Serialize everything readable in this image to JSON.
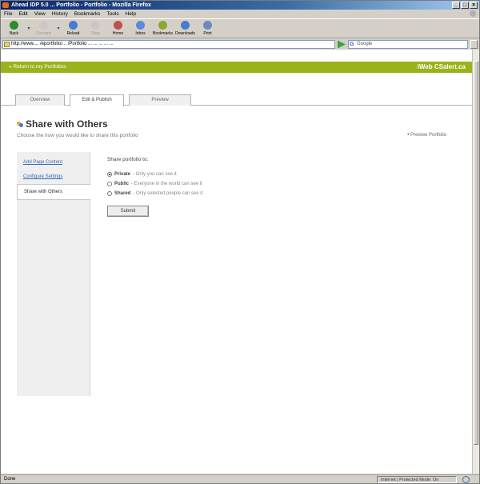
{
  "window": {
    "title": "Ahead IDP 5.0 ... Portfolio - Portfolio - Mozilla Firefox",
    "controls": [
      "_",
      "□",
      "×"
    ]
  },
  "menu": [
    "File",
    "Edit",
    "View",
    "History",
    "Bookmarks",
    "Tools",
    "Help"
  ],
  "toolbar": [
    {
      "label": "Back",
      "icon": "back-arrow-icon",
      "color": "#2e8b2e",
      "enabled": true
    },
    {
      "label": "Forward",
      "icon": "forward-arrow-icon",
      "color": "#c8c8c8",
      "enabled": false
    },
    {
      "label": "Reload",
      "icon": "reload-icon",
      "color": "#4a7bd0",
      "enabled": true
    },
    {
      "label": "Stop",
      "icon": "stop-icon",
      "color": "#c8c8c8",
      "enabled": false
    },
    {
      "label": "Home",
      "icon": "home-icon",
      "color": "#c0504d",
      "enabled": true
    },
    {
      "label": "Inbox",
      "icon": "inbox-icon",
      "color": "#5a8ad8",
      "enabled": true
    },
    {
      "label": "Bookmarks",
      "icon": "bookmarks-icon",
      "color": "#8aa830",
      "enabled": true
    },
    {
      "label": "Downloads",
      "icon": "downloads-icon",
      "color": "#4a7bd0",
      "enabled": true
    },
    {
      "label": "Print",
      "icon": "print-icon",
      "color": "#6a8ac0",
      "enabled": true
    }
  ],
  "address": {
    "url": "http://www.... /eportfolio/... /Portfolio ... ... ... ... ...",
    "search_placeholder": "Google"
  },
  "page": {
    "return_link": "« Return to my Portfolios",
    "brand": "iWeb CSalert.ca",
    "tabs": [
      "Overview",
      "Edit & Publish",
      "Preview"
    ],
    "active_tab": 1,
    "title": "Share with Others",
    "subtitle": "Choose the how you would like to share this portfolio",
    "preview_link": "Preview Portfolio",
    "sidenav": [
      {
        "label": "Add Page Content",
        "active": false
      },
      {
        "label": "Configure Settings",
        "active": false
      },
      {
        "label": "Share with Others",
        "active": true
      }
    ],
    "form": {
      "heading": "Share portfolio to:",
      "options": [
        {
          "label": "Private",
          "desc": "- Only you can see it",
          "selected": true
        },
        {
          "label": "Public",
          "desc": "- Everyone in the world can see it",
          "selected": false
        },
        {
          "label": "Shared",
          "desc": "- Only selected people can see it",
          "selected": false
        }
      ],
      "submit_label": "Submit"
    }
  },
  "status": {
    "left": "Done",
    "zone": "Internet | Protected Mode: On"
  },
  "colors": {
    "header_green": "#9cb21a",
    "link_blue": "#3a6ab0"
  }
}
